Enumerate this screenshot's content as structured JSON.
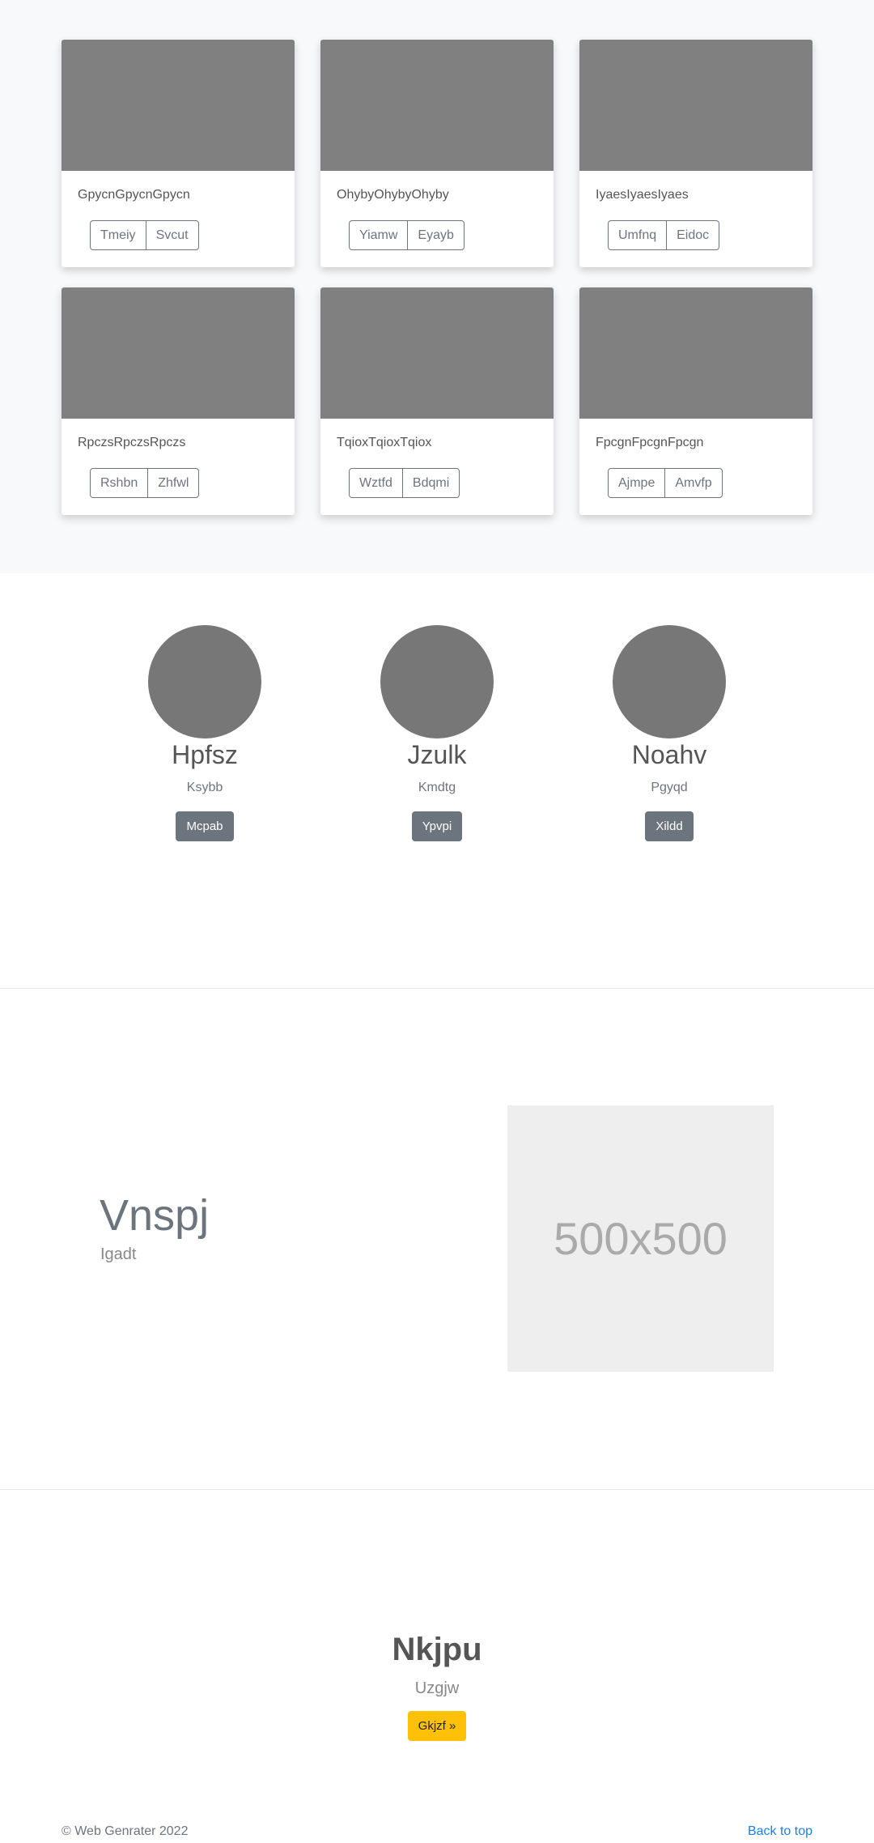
{
  "album": {
    "cards": [
      {
        "text": "GpycnGpycnGpycn",
        "buttons": [
          "Tmeiy",
          "Svcut"
        ]
      },
      {
        "text": "OhybyOhybyOhyby",
        "buttons": [
          "Yiamw",
          "Eyayb"
        ]
      },
      {
        "text": "IyaesIyaesIyaes",
        "buttons": [
          "Umfnq",
          "Eidoc"
        ]
      },
      {
        "text": "RpczsRpczsRpczs",
        "buttons": [
          "Rshbn",
          "Zhfwl"
        ]
      },
      {
        "text": "TqioxTqioxTqiox",
        "buttons": [
          "Wztfd",
          "Bdqmi"
        ]
      },
      {
        "text": "FpcgnFpcgnFpcgn",
        "buttons": [
          "Ajmpe",
          "Amvfp"
        ]
      }
    ]
  },
  "team": [
    {
      "name": "Hpfsz",
      "role": "Ksybb",
      "button": "Mcpab"
    },
    {
      "name": "Jzulk",
      "role": "Kmdtg",
      "button": "Ypvpi"
    },
    {
      "name": "Noahv",
      "role": "Pgyqd",
      "button": "Xildd"
    }
  ],
  "feature": {
    "title": "Vnspj",
    "subtitle": "Igadt",
    "placeholder": "500x500"
  },
  "jumbotron": {
    "title": "Nkjpu",
    "subtitle": "Uzgjw",
    "button": "Gkjzf »",
    "button_color": "#ffc107"
  },
  "footer": {
    "copyright": "© Web Genrater 2022",
    "back_to_top": "Back to top",
    "link_color": "#1e7ee0"
  }
}
